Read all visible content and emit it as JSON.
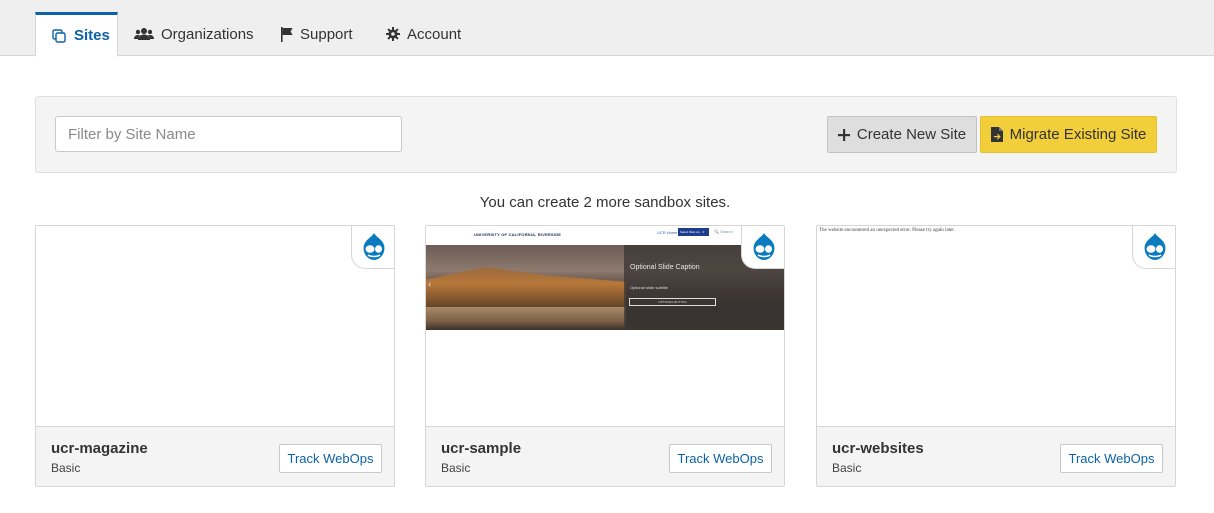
{
  "tabs": [
    {
      "label": "Sites",
      "icon": "sites-icon",
      "active": true
    },
    {
      "label": "Organizations",
      "icon": "users-icon",
      "active": false
    },
    {
      "label": "Support",
      "icon": "flag-icon",
      "active": false
    },
    {
      "label": "Account",
      "icon": "gear-icon",
      "active": false
    }
  ],
  "toolbar": {
    "filter_placeholder": "Filter by Site Name",
    "filter_value": "",
    "create_label": "Create New Site",
    "migrate_label": "Migrate Existing Site"
  },
  "sandbox_note": "You can create 2 more sandbox sites.",
  "sites": [
    {
      "name": "ucr-magazine",
      "plan": "Basic",
      "action": "Track WebOps",
      "preview": "blank"
    },
    {
      "name": "ucr-sample",
      "plan": "Basic",
      "action": "Track WebOps",
      "preview": "homepage",
      "preview_text": {
        "university": "UNIVERSITY OF CALIFORNIA, RIVERSIDE",
        "links": "UCR Home",
        "menu_button": "Select Web Ac... ▾",
        "search": "🔍 Search",
        "caption": "Optional Slide Caption",
        "subcaption": "Optional slide subtitle",
        "cta": "OPTIONAL BUTTON"
      }
    },
    {
      "name": "ucr-websites",
      "plan": "Basic",
      "action": "Track WebOps",
      "preview": "error",
      "preview_text": {
        "error": "The website encountered an unexpected error. Please try again later."
      }
    }
  ],
  "colors": {
    "accent": "#0b62a6",
    "migrate": "#f2cf3a",
    "drupal": "#0a7bbf"
  }
}
